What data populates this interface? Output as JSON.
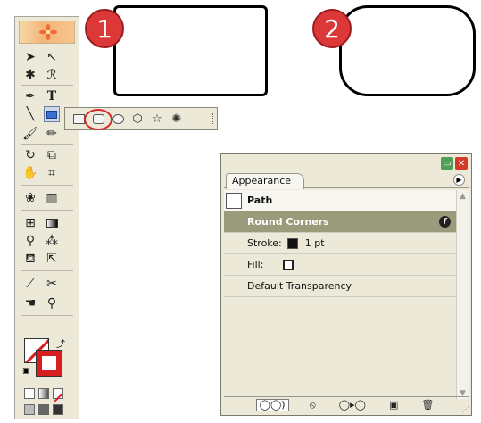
{
  "badges": {
    "one": "1",
    "two": "2"
  },
  "appearance_panel": {
    "tab_label": "Appearance",
    "object_label": "Path",
    "items": {
      "effect": "Round Corners",
      "stroke_label": "Stroke:",
      "stroke_value": "1 pt",
      "fill_label": "Fill:",
      "transparency": "Default Transparency"
    }
  },
  "tools": {
    "type_tool_label": "T",
    "stroke_color": "#d81e1e"
  },
  "colors": {
    "badge_red": "#dc3838",
    "highlight_red": "#d42a2a",
    "selected_row": "#9a9b7a"
  }
}
